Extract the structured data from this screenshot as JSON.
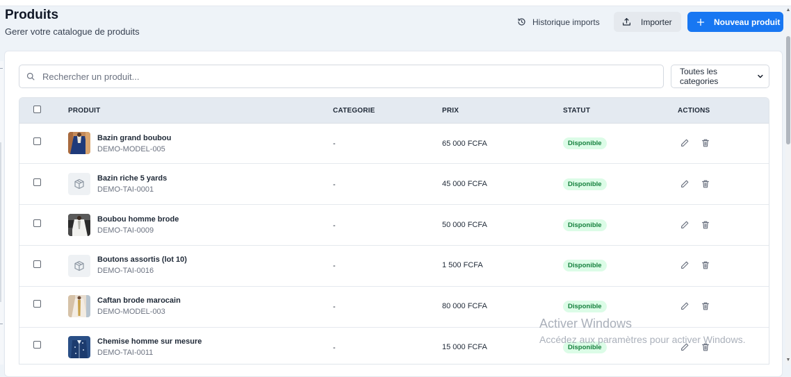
{
  "header": {
    "title": "Produits",
    "subtitle": "Gerer votre catalogue de produits"
  },
  "toolbar": {
    "history_label": "Historique imports",
    "import_label": "Importer",
    "new_label": "Nouveau produit"
  },
  "search": {
    "placeholder": "Rechercher un produit..."
  },
  "category_filter": {
    "selected": "Toutes les categories"
  },
  "table": {
    "headers": {
      "produit": "PRODUIT",
      "categorie": "CATEGORIE",
      "prix": "PRIX",
      "statut": "STATUT",
      "actions": "ACTIONS"
    },
    "rows": [
      {
        "name": "Bazin grand boubou",
        "sku": "DEMO-MODEL-005",
        "category": "-",
        "price": "65 000 FCFA",
        "status": "Disponible",
        "image": "photo-blue-boubou"
      },
      {
        "name": "Bazin riche 5 yards",
        "sku": "DEMO-TAI-0001",
        "category": "-",
        "price": "45 000 FCFA",
        "status": "Disponible",
        "image": "box-icon"
      },
      {
        "name": "Boubou homme brode",
        "sku": "DEMO-TAI-0009",
        "category": "-",
        "price": "50 000 FCFA",
        "status": "Disponible",
        "image": "photo-embroidered-boubou"
      },
      {
        "name": "Boutons assortis (lot 10)",
        "sku": "DEMO-TAI-0016",
        "category": "-",
        "price": "1 500 FCFA",
        "status": "Disponible",
        "image": "box-icon"
      },
      {
        "name": "Caftan brode marocain",
        "sku": "DEMO-MODEL-003",
        "category": "-",
        "price": "80 000 FCFA",
        "status": "Disponible",
        "image": "photo-caftan"
      },
      {
        "name": "Chemise homme sur mesure",
        "sku": "DEMO-TAI-0011",
        "category": "-",
        "price": "15 000 FCFA",
        "status": "Disponible",
        "image": "photo-shirt"
      }
    ]
  },
  "watermark": {
    "line1": "Activer Windows",
    "line2": "Accédez aux paramètres pour activer Windows."
  },
  "colors": {
    "primary": "#1877f2",
    "status_bg": "#dcfce7",
    "status_text": "#15803d",
    "header_bg": "#e4eaf1"
  }
}
